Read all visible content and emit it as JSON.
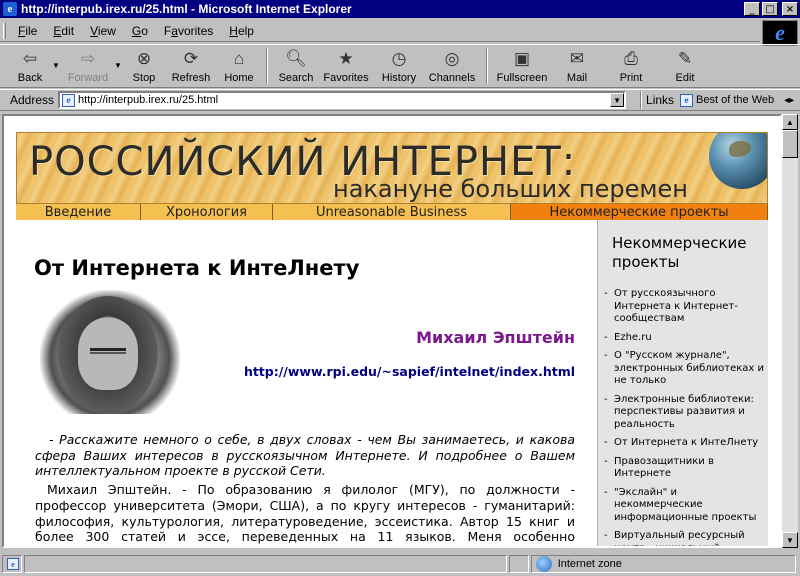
{
  "window": {
    "title": "http://interpub.irex.ru/25.html - Microsoft Internet Explorer",
    "app_icon": "ie-icon",
    "controls": {
      "minimize": "_",
      "maximize": "□",
      "close": "×"
    }
  },
  "menu": [
    {
      "label": "File",
      "key": "F",
      "rest": "ile"
    },
    {
      "label": "Edit",
      "key": "E",
      "rest": "dit"
    },
    {
      "label": "View",
      "key": "V",
      "rest": "iew"
    },
    {
      "label": "Go",
      "key": "G",
      "rest": "o"
    },
    {
      "label": "Favorites",
      "key": "a",
      "pre": "F",
      "rest": "vorites"
    },
    {
      "label": "Help",
      "key": "H",
      "rest": "elp"
    }
  ],
  "toolbar": {
    "back": "Back",
    "forward": "Forward",
    "stop": "Stop",
    "refresh": "Refresh",
    "home": "Home",
    "search": "Search",
    "favorites": "Favorites",
    "history": "History",
    "channels": "Channels",
    "fullscreen": "Fullscreen",
    "mail": "Mail",
    "print": "Print",
    "edit": "Edit"
  },
  "address": {
    "label": "Address",
    "url": "http://interpub.irex.ru/25.html",
    "links_label": "Links",
    "best_of_web": "Best of the Web"
  },
  "page": {
    "banner_title": "РОССИЙСКИЙ ИНТЕРНЕТ:",
    "banner_subtitle": "накануне больших перемен",
    "nav": [
      {
        "label": "Введение",
        "active": false
      },
      {
        "label": "Хронология",
        "active": false
      },
      {
        "label": "Unreasonable Business",
        "active": false
      },
      {
        "label": "Некоммерческие проекты",
        "active": true
      }
    ],
    "title": "От Интернета к ИнтеЛнету",
    "author": "Михаил Эпштейн",
    "author_url": "http://www.rpi.edu/~sapief/intelnet/index.html",
    "question": "- Расскажите немного о себе, в двух словах - чем Вы занимаетесь, и какова сфера Ваших интересов в русскоязычном Интернете. И подробнее о Вашем интеллектуальном проекте в русской Сети.",
    "answer": "Михаил Эпштейн. - По образованию я филолог (МГУ), по должности - профессор университета (Эмори, США), а по кругу интересов - гуманитарий: философия, культурология, литературоведение, эссеистика. Автор 15 книг и более 300 статей и эссе, переведенных на 11 языков. Меня особенно интересуют новые парадигмы художественного и теоретического мышления, в"
  },
  "sidebar": {
    "title": "Некоммерческие проекты",
    "items": [
      "От русскоязычного Интернета к Интернет-сообществам",
      "Ezhe.ru",
      "О \"Русском журнале\", электронных библиотеках и не только",
      "Электронные библиотеки: перспективы развития и реальность",
      "От Интернета к ИнтеЛнету",
      "Правозащитники в Интернете",
      "\"Экслайн\" и некоммерческие информационные проекты",
      "Виртуальный ресурсный центр - уникальный"
    ]
  },
  "status": {
    "zone": "Internet zone"
  }
}
